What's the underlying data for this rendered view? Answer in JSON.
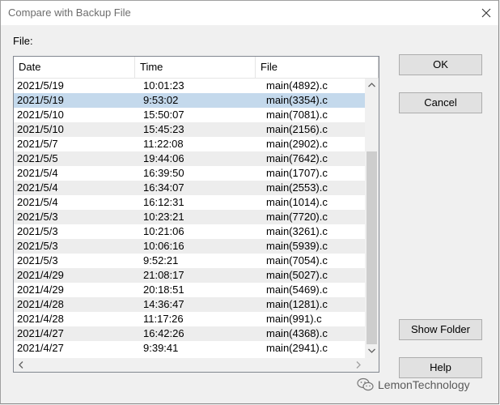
{
  "window": {
    "title": "Compare with Backup File"
  },
  "file_label": "File:",
  "columns": [
    "Date",
    "Time",
    "File"
  ],
  "rows": [
    {
      "date": "2021/5/19",
      "time": "10:01:23",
      "file": "main(4892).c"
    },
    {
      "date": "2021/5/19",
      "time": "9:53:02",
      "file": "main(3354).c"
    },
    {
      "date": "2021/5/10",
      "time": "15:50:07",
      "file": "main(7081).c"
    },
    {
      "date": "2021/5/10",
      "time": "15:45:23",
      "file": "main(2156).c"
    },
    {
      "date": "2021/5/7",
      "time": "11:22:08",
      "file": "main(2902).c"
    },
    {
      "date": "2021/5/5",
      "time": "19:44:06",
      "file": "main(7642).c"
    },
    {
      "date": "2021/5/4",
      "time": "16:39:50",
      "file": "main(1707).c"
    },
    {
      "date": "2021/5/4",
      "time": "16:34:07",
      "file": "main(2553).c"
    },
    {
      "date": "2021/5/4",
      "time": "16:12:31",
      "file": "main(1014).c"
    },
    {
      "date": "2021/5/3",
      "time": "10:23:21",
      "file": "main(7720).c"
    },
    {
      "date": "2021/5/3",
      "time": "10:21:06",
      "file": "main(3261).c"
    },
    {
      "date": "2021/5/3",
      "time": "10:06:16",
      "file": "main(5939).c"
    },
    {
      "date": "2021/5/3",
      "time": "9:52:21",
      "file": "main(7054).c"
    },
    {
      "date": "2021/4/29",
      "time": "21:08:17",
      "file": "main(5027).c"
    },
    {
      "date": "2021/4/29",
      "time": "20:18:51",
      "file": "main(5469).c"
    },
    {
      "date": "2021/4/28",
      "time": "14:36:47",
      "file": "main(1281).c"
    },
    {
      "date": "2021/4/28",
      "time": "11:17:26",
      "file": "main(991).c"
    },
    {
      "date": "2021/4/27",
      "time": "16:42:26",
      "file": "main(4368).c"
    },
    {
      "date": "2021/4/27",
      "time": "9:39:41",
      "file": "main(2941).c"
    }
  ],
  "selected_row_index": 1,
  "buttons": {
    "ok": "OK",
    "cancel": "Cancel",
    "show_folder": "Show Folder",
    "help": "Help"
  },
  "watermark": "LemonTechnology",
  "colors": {
    "selection": "#c4d9ec",
    "alt_row": "#ededed",
    "button_face": "#e1e1e1"
  },
  "icons": [
    "close-icon",
    "scroll-up-icon",
    "scroll-down-icon",
    "scroll-left-icon",
    "scroll-right-icon",
    "wechat-icon"
  ]
}
